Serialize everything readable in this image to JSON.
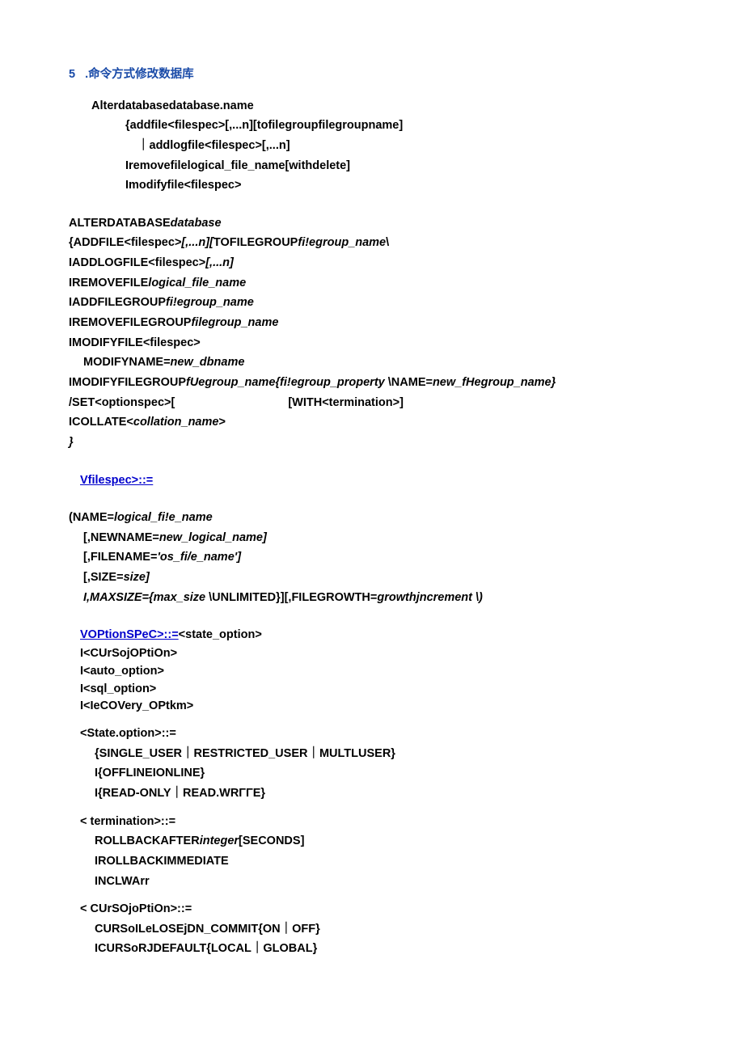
{
  "heading": {
    "num": "5",
    "title": ".命令方式修改数据库"
  },
  "l1": "Alterdatabasedatabase.name",
  "l2": "{addfile<filespec>[,...n][tofilegroupfilegroupname]",
  "l3_pre": "｜",
  "l3": "addlogfile<filespec>[,...n]",
  "l4": "Iremovefilelogical_file_name[withdelete]",
  "l5": "Imodifyfile<filespec>",
  "a1a": "ALTERDATABASE",
  "a1b": "database",
  "a2a": "{ADDFILE<filespec>",
  "a2b": "[,...n][",
  "a2c": "TOFILEGROUP",
  "a2d": "fi!egroup_name",
  "a2e": "\\",
  "a3a": "IADDLOGFILE<filespec>",
  "a3b": "[,...n]",
  "a4a": "IREMOVEFILE",
  "a4b": "logical_file_name",
  "a5a": "IADDFILEGROUP",
  "a5b": "fi!egroup_name",
  "a6a": "IREMOVEFILEGROUP",
  "a6b": "filegroup_name",
  "a7": "IMODIFYFILE<filespec>",
  "a8a": "MODIFYNAME=",
  "a8b": "new_dbname",
  "a9a": "IMODIFYFILEGROUP",
  "a9b": "fUegroup_name{fi!egroup_property",
  "a9c": " \\NAME=",
  "a9d": "new_fHegroup_name}",
  "a10": "/SET<optionspec>[",
  "a10b": "[WITH<termination>]",
  "a11a": "ICOLLATE<",
  "a11b": "collation_name",
  "a11c": ">",
  "a12": "}",
  "fs_head": "Vfilespec>::=",
  "fs1a": "(NAME=",
  "fs1b": "logical_fi!e_name",
  "fs2a": "[,NEWNAME=",
  "fs2b": "new_logical_name]",
  "fs3a": "[,FILENAME=",
  "fs3b": "'os_fi/e_name']",
  "fs4a": "[,SIZE=",
  "fs4b": "size]",
  "fs5a": "I,MAXSIZE={",
  "fs5b": "max_size",
  "fs5c": " \\UNLIMITED}][,FILEGROWTH=",
  "fs5d": "growthjncrement",
  "fs5e": " \\)",
  "op_head": "VOPtionSPeC>::=",
  "op_head2": "<state_option>",
  "op1": "I<CUrSojOPtiOn>",
  "op2": "I<auto_option>",
  "op3": "I<sql_option>",
  "op4": "I<IeCOVery_OPtkm>",
  "st_h": "<State.option>::=",
  "st1": "{SINGLE_USER｜RESTRICTED_USER｜MULTLUSER}",
  "st2": "I{OFFLINEIONLINE}",
  "st3": "I{READ-ONLY｜READ.WRΓΓE}",
  "te_h": "<   termination>::=",
  "te1a": "ROLLBACKAFTER",
  "te1b": "integer",
  "te1c": "[SECONDS]",
  "te2": "IROLLBACKIMMEDIATE",
  "te3": "INCLWArr",
  "cu_h": "<   CUrSOjoPtiOn>::=",
  "cu1": "CURSoILeLOSEjDN_COMMIT{ON｜OFF}",
  "cu2": "ICURSoRJDEFAULT{LOCAL｜GLOBAL}"
}
